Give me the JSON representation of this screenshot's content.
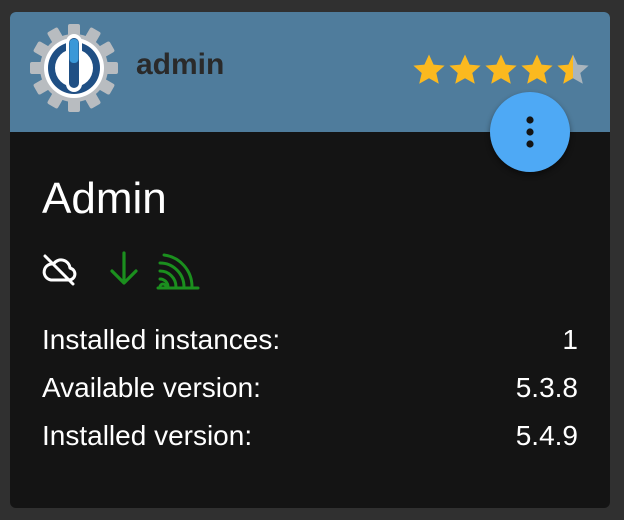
{
  "adapter": {
    "name": "admin",
    "title": "Admin",
    "rating": {
      "value": 4.5,
      "max": 5
    },
    "status_icons": [
      "cloud-off-icon",
      "arrow-down-icon",
      "signal-icon"
    ],
    "info": [
      {
        "label": "Installed instances:",
        "value": "1"
      },
      {
        "label": "Available version:",
        "value": "5.3.8"
      },
      {
        "label": "Installed version:",
        "value": "5.4.9"
      }
    ]
  },
  "colors": {
    "page_background": "#303030",
    "card_background": "#141414",
    "header_background": "#4f7c9c",
    "fab_background": "#4ea9f5",
    "star": "#fbb91f",
    "star_empty": "#aab5bd",
    "status_green": "#1b8f1e",
    "text": "#ffffff"
  }
}
